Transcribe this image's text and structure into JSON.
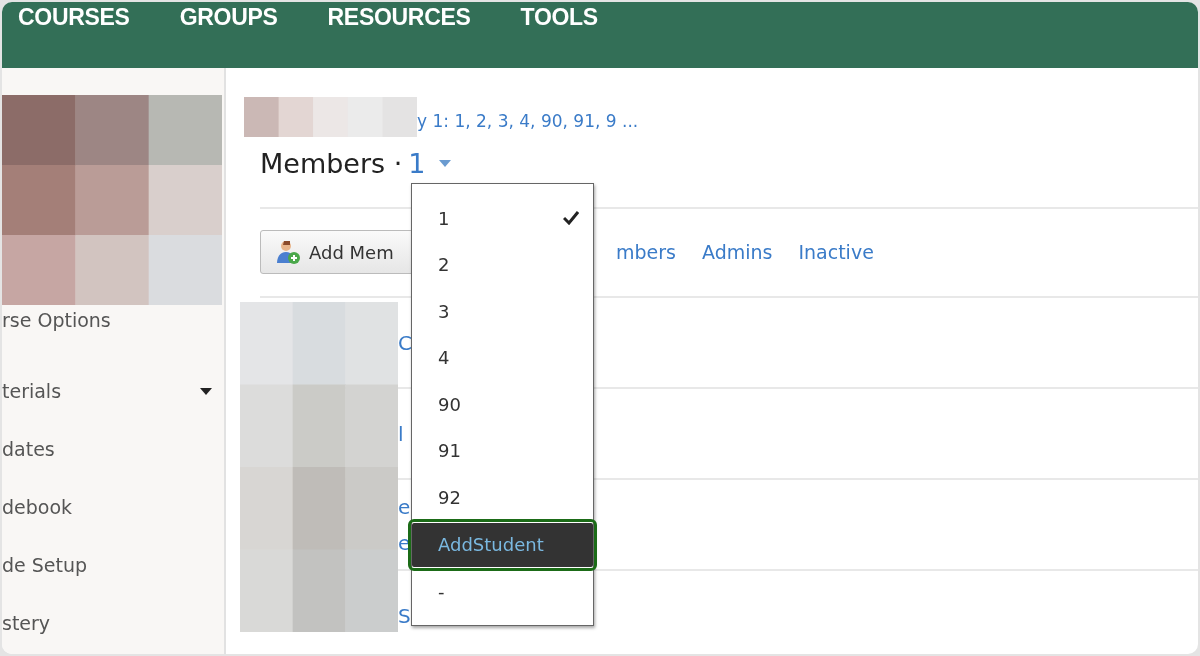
{
  "nav": {
    "items": [
      "COURSES",
      "GROUPS",
      "RESOURCES",
      "TOOLS"
    ]
  },
  "sidebar": {
    "items": [
      {
        "label": "rse Options",
        "has_menu": false
      },
      {
        "label": "terials",
        "has_menu": true
      },
      {
        "label": "dates",
        "has_menu": false
      },
      {
        "label": "debook",
        "has_menu": false
      },
      {
        "label": "de Setup",
        "has_menu": false
      },
      {
        "label": "stery",
        "has_menu": false
      }
    ]
  },
  "breadcrumb": {
    "link": "y 1: 1, 2, 3, 4, 90, 91, 9 ..."
  },
  "heading": {
    "title": "Members ·",
    "value": "1"
  },
  "toolbar": {
    "button": "Add Mem",
    "links": [
      "mbers",
      "Admins",
      "Inactive"
    ]
  },
  "rows": [
    {
      "texts": [
        "C"
      ]
    },
    {
      "texts": [
        "l"
      ]
    },
    {
      "texts": [
        "e",
        "e"
      ]
    },
    {
      "texts": [
        "S"
      ]
    }
  ],
  "dropdown": {
    "items": [
      {
        "label": "1",
        "selected": true,
        "highlighted": false
      },
      {
        "label": "2",
        "selected": false,
        "highlighted": false
      },
      {
        "label": "3",
        "selected": false,
        "highlighted": false
      },
      {
        "label": "4",
        "selected": false,
        "highlighted": false
      },
      {
        "label": "90",
        "selected": false,
        "highlighted": false
      },
      {
        "label": "91",
        "selected": false,
        "highlighted": false
      },
      {
        "label": "92",
        "selected": false,
        "highlighted": false
      },
      {
        "label": "AddStudent",
        "selected": false,
        "highlighted": true
      },
      {
        "label": "-",
        "selected": false,
        "highlighted": false
      }
    ]
  }
}
